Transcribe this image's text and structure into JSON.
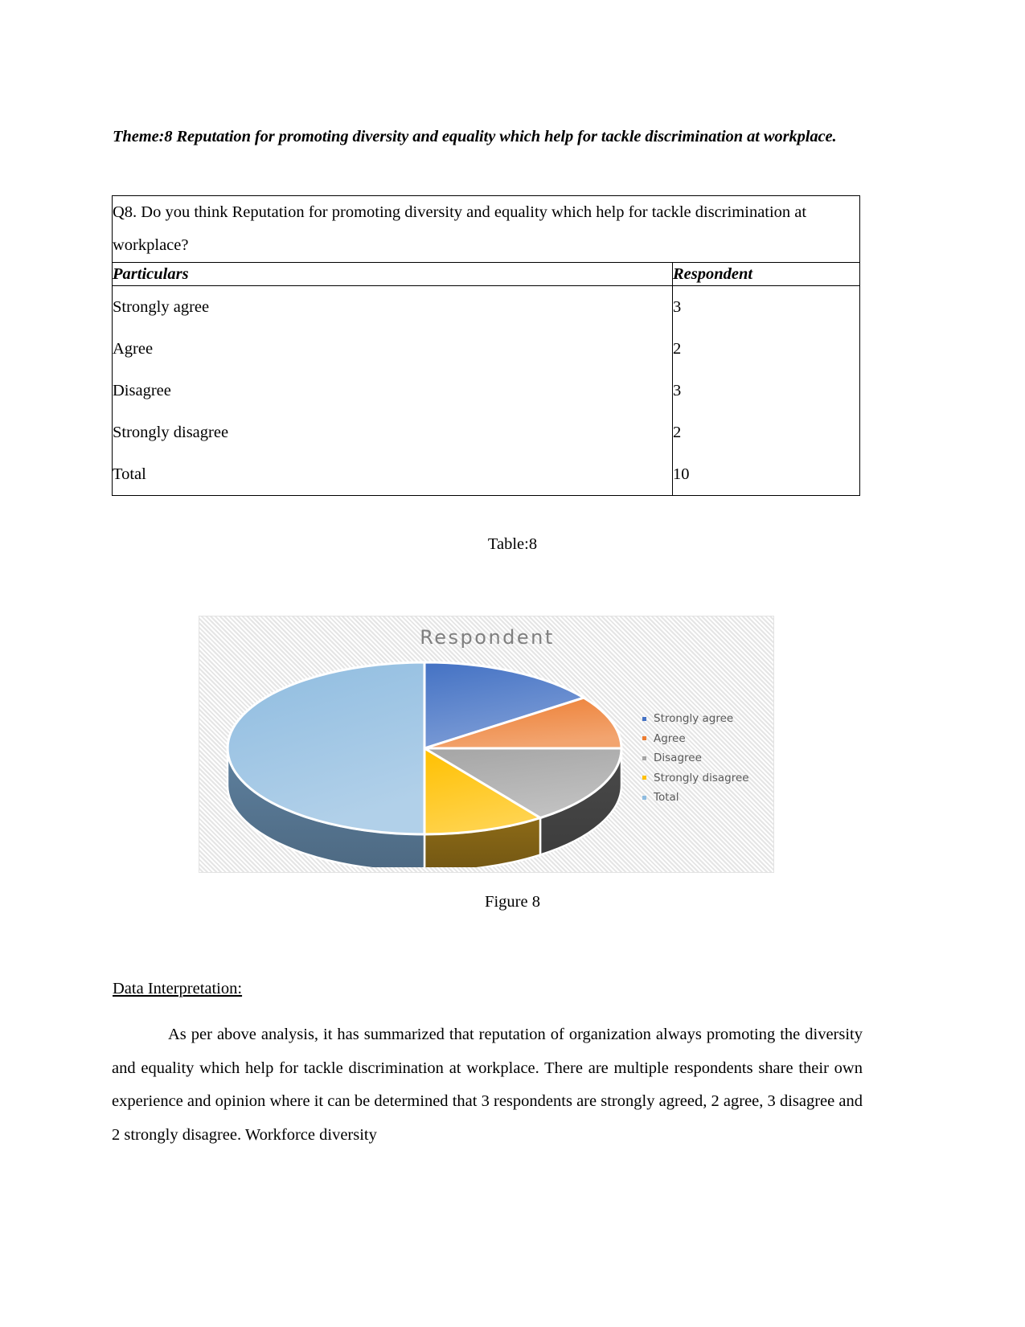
{
  "theme": {
    "heading": "Theme:8 Reputation for promoting diversity and equality which help for tackle discrimination at workplace."
  },
  "table": {
    "question": "Q8. Do you think Reputation for promoting diversity and equality which help for tackle discrimination at workplace?",
    "headers": [
      "Particulars",
      "Respondent"
    ],
    "rows": [
      {
        "particular": "Strongly agree",
        "respondent": "3"
      },
      {
        "particular": "Agree",
        "respondent": "2"
      },
      {
        "particular": "Disagree",
        "respondent": "3"
      },
      {
        "particular": "Strongly disagree",
        "respondent": "2"
      },
      {
        "particular": "Total",
        "respondent": "10"
      }
    ],
    "caption": "Table:8"
  },
  "figure": {
    "caption": "Figure 8"
  },
  "chart_data": {
    "type": "pie",
    "title": "Respondent",
    "categories": [
      "Strongly agree",
      "Agree",
      "Disagree",
      "Strongly disagree",
      "Total"
    ],
    "values": [
      3,
      2,
      3,
      2,
      10
    ],
    "colors": [
      "#4472C4",
      "#ED7D31",
      "#A5A5A5",
      "#FFC000",
      "#8FBCE0"
    ],
    "side_colors": [
      "#2F4F8F",
      "#A55620",
      "#4A4A4A",
      "#8C6A17",
      "#5E809E"
    ],
    "legend_position": "right",
    "three_d": true,
    "xlabel": "",
    "ylabel": ""
  },
  "interpretation": {
    "heading": "Data Interpretation:",
    "body": "As per above analysis, it has summarized that reputation of organization always promoting the diversity and equality which help for tackle discrimination at workplace. There are multiple respondents share their own experience and opinion where it can be determined that 3 respondents are strongly agreed, 2 agree, 3 disagree and 2 strongly disagree. Workforce diversity"
  }
}
